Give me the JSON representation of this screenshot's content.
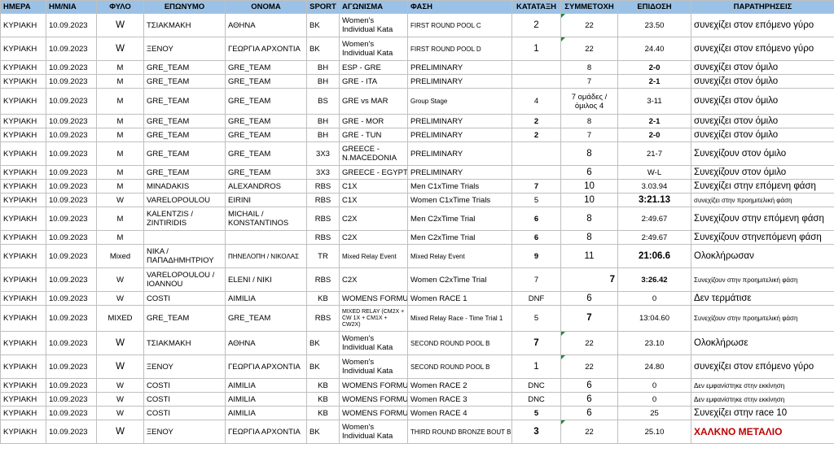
{
  "headers": [
    "ΗΜΕΡΑ",
    "ΗΜ/ΝΙΑ",
    "ΦΥΛΟ",
    "ΕΠΩΝΥΜΟ",
    "ΟΝΟΜΑ",
    "SPORT",
    "ΑΓΩΝΙΣΜΑ",
    "ΦΑΣΗ",
    "ΚΑΤΑΤΑΞΗ",
    "ΣΥΜΜΕΤΟΧΗ",
    "ΕΠΙΔΟΣΗ",
    "ΠΑΡΑΤΗΡΗΣΕΙΣ"
  ],
  "rows": [
    [
      "ΚΥΡΙΑΚΗ",
      "10.09.2023",
      "W",
      "ΤΣΙΑΚΜΑΚΗ",
      "ΑΘΗΝΑ",
      "BK",
      "Women's Individual Kata",
      "FIRST ROUND POOL C",
      "2",
      "22",
      "23.50",
      "συνεχίζει στον επόμενο γύρο"
    ],
    [
      "ΚΥΡΙΑΚΗ",
      "10.09.2023",
      "W",
      "ΞΕΝΟΥ",
      "ΓΕΩΡΓΙΑ ΑΡΧΟΝΤΙΑ",
      "BK",
      "Women's Individual Kata",
      "FIRST ROUND POOL D",
      "1",
      "22",
      "24.40",
      "συνεχίζει στον επόμενο γύρο"
    ],
    [
      "ΚΥΡΙΑΚΗ",
      "10.09.2023",
      "M",
      "GRE_TEAM",
      "GRE_TEAM",
      "BH",
      "ESP - GRE",
      "PRELIMINARY",
      "",
      "8",
      "2-0",
      "συνεχίζει στον όμιλο"
    ],
    [
      "ΚΥΡΙΑΚΗ",
      "10.09.2023",
      "M",
      "GRE_TEAM",
      "GRE_TEAM",
      "BH",
      "GRE - ITA",
      "PRELIMINARY",
      "",
      "7",
      "2-1",
      "συνεχίζει στον όμιλο"
    ],
    [
      "ΚΥΡΙΑΚΗ",
      "10.09.2023",
      "M",
      "GRE_TEAM",
      "GRE_TEAM",
      "BS",
      "GRE vs MAR",
      "Group Stage",
      "4",
      "7 ομάδες / όμιλος 4",
      "3-11",
      "συνεχίζει στον όμιλο"
    ],
    [
      "ΚΥΡΙΑΚΗ",
      "10.09.2023",
      "M",
      "GRE_TEAM",
      "GRE_TEAM",
      "BH",
      "GRE - MOR",
      "PRELIMINARY",
      "2",
      "8",
      "2-1",
      "συνεχίζει στον όμιλο"
    ],
    [
      "ΚΥΡΙΑΚΗ",
      "10.09.2023",
      "M",
      "GRE_TEAM",
      "GRE_TEAM",
      "BH",
      "GRE - TUN",
      "PRELIMINARY",
      "2",
      "7",
      "2-0",
      "συνεχίζει στον όμιλο"
    ],
    [
      "ΚΥΡΙΑΚΗ",
      "10.09.2023",
      "M",
      "GRE_TEAM",
      "GRE_TEAM",
      "3X3",
      "GREECE - N.MACEDONIA",
      "PRELIMINARY",
      "",
      "8",
      "21-7",
      "Συνεχίζουν στον όμιλο"
    ],
    [
      "ΚΥΡΙΑΚΗ",
      "10.09.2023",
      "M",
      "GRE_TEAM",
      "GRE_TEAM",
      "3X3",
      "GREECE - EGYPT",
      "PRELIMINARY",
      "",
      "6",
      "W-L",
      "Συνεχίζουν στον όμιλο"
    ],
    [
      "ΚΥΡΙΑΚΗ",
      "10.09.2023",
      "M",
      "MINADAKIS",
      "ALEXANDROS",
      "RBS",
      "C1X",
      "Men C1xTime Trials",
      "7",
      "10",
      "3.03.94",
      "Συνεχίζει στην επόμενη φάση"
    ],
    [
      "ΚΥΡΙΑΚΗ",
      "10.09.2023",
      "W",
      "VARELOPOULOU",
      "EIRINI",
      "RBS",
      "C1X",
      "Women C1xTime Trials",
      "5",
      "10",
      "3:21.13",
      "συνεχίζει στην προημιτελική φάση"
    ],
    [
      "ΚΥΡΙΑΚΗ",
      "10.09.2023",
      "M",
      "KALENTZIS / ZINTIRIDIS",
      "MICHAIL / KONSTANTINOS",
      "RBS",
      "C2X",
      "Men C2xTime Trial",
      "6",
      "8",
      "2:49.67",
      "Συνεχίζουν στην επόμενη φάση"
    ],
    [
      "ΚΥΡΙΑΚΗ",
      "10.09.2023",
      "M",
      "",
      "",
      "RBS",
      "C2X",
      "Men C2xTime Trial",
      "6",
      "8",
      "2:49.67",
      "Συνεχίζουν στηνεπόμενη φάση"
    ],
    [
      "ΚΥΡΙΑΚΗ",
      "10.09.2023",
      "Mixed",
      "ΝΙΚΑ / ΠΑΠΑΔΗΜΗΤΡΙΟΥ",
      "ΠΗΝΕΛΟΠΗ / ΝΙΚΟΛΑΣ",
      "TR",
      "Mixed Relay Event",
      "Mixed Relay Event",
      "9",
      "11",
      "21:06.6",
      "Ολοκλήρωσαν"
    ],
    [
      "ΚΥΡΙΑΚΗ",
      "10.09.2023",
      "W",
      "VARELOPOULOU / IOANNOU",
      "ELENI / NIKI",
      "RBS",
      "C2X",
      "Women C2xTime Trial",
      "7",
      "7",
      "3:26.42",
      "Συνεχίζουν  στην προημιτελική φάση"
    ],
    [
      "ΚΥΡΙΑΚΗ",
      "10.09.2023",
      "W",
      "COSTI",
      "AIMILIA",
      "KB",
      "WOMENS FORMULA",
      "Women RACE 1",
      "DNF",
      "6",
      "0",
      "Δεν τερμάτισε"
    ],
    [
      "ΚΥΡΙΑΚΗ",
      "10.09.2023",
      "MIXED",
      "GRE_TEAM",
      "GRE_TEAM",
      "RBS",
      "MIXED RELAY (CM2X + CW 1X + CM1X + CW2X)",
      "Mixed Relay Race - Time Trial 1",
      "5",
      "7",
      "13:04.60",
      "Συνεχίζουν στην προημιτελική φάση"
    ],
    [
      "ΚΥΡΙΑΚΗ",
      "10.09.2023",
      "W",
      "ΤΣΙΑΚΜΑΚΗ",
      "ΑΘΗΝΑ",
      "BK",
      "Women's Individual Kata",
      "SECOND ROUND POOL B",
      "7",
      "22",
      "23.10",
      "Ολοκλήρωσε"
    ],
    [
      "ΚΥΡΙΑΚΗ",
      "10.09.2023",
      "W",
      "ΞΕΝΟΥ",
      "ΓΕΩΡΓΙΑ ΑΡΧΟΝΤΙΑ",
      "BK",
      "Women's Individual Kata",
      "SECOND ROUND POOL B",
      "1",
      "22",
      "24.80",
      "συνεχίζει στον επόμενο γύρο"
    ],
    [
      "ΚΥΡΙΑΚΗ",
      "10.09.2023",
      "W",
      "COSTI",
      "AIMILIA",
      "KB",
      "WOMENS FORMULA",
      "Women RACE 2",
      "DNC",
      "6",
      "0",
      "Δεν εμφανίστηκε στην εκκίνηση"
    ],
    [
      "ΚΥΡΙΑΚΗ",
      "10.09.2023",
      "W",
      "COSTI",
      "AIMILIA",
      "KB",
      "WOMENS FORMULA",
      "Women RACE 3",
      "DNC",
      "6",
      "0",
      "Δεν εμφανίστηκε στην εκκίνηση"
    ],
    [
      "ΚΥΡΙΑΚΗ",
      "10.09.2023",
      "W",
      "COSTI",
      "AIMILIA",
      "KB",
      "WOMENS FORMULA",
      "Women RACE 4",
      "5",
      "6",
      "25",
      "Συνεχίζει στην race 10"
    ],
    [
      "ΚΥΡΙΑΚΗ",
      "10.09.2023",
      "W",
      "ΞΕΝΟΥ",
      "ΓΕΩΡΓΙΑ ΑΡΧΟΝΤΙΑ",
      "BK",
      "Women's Individual Kata",
      "THIRD ROUND BRONZE BOUT B",
      "3",
      "22",
      "25.10",
      "ΧΑΛΚΝΟ ΜΕΤΑΛΙΟ"
    ]
  ],
  "colors": {
    "header_bg": "#9bc2e6",
    "comment_mark": "#1e8a3a"
  }
}
